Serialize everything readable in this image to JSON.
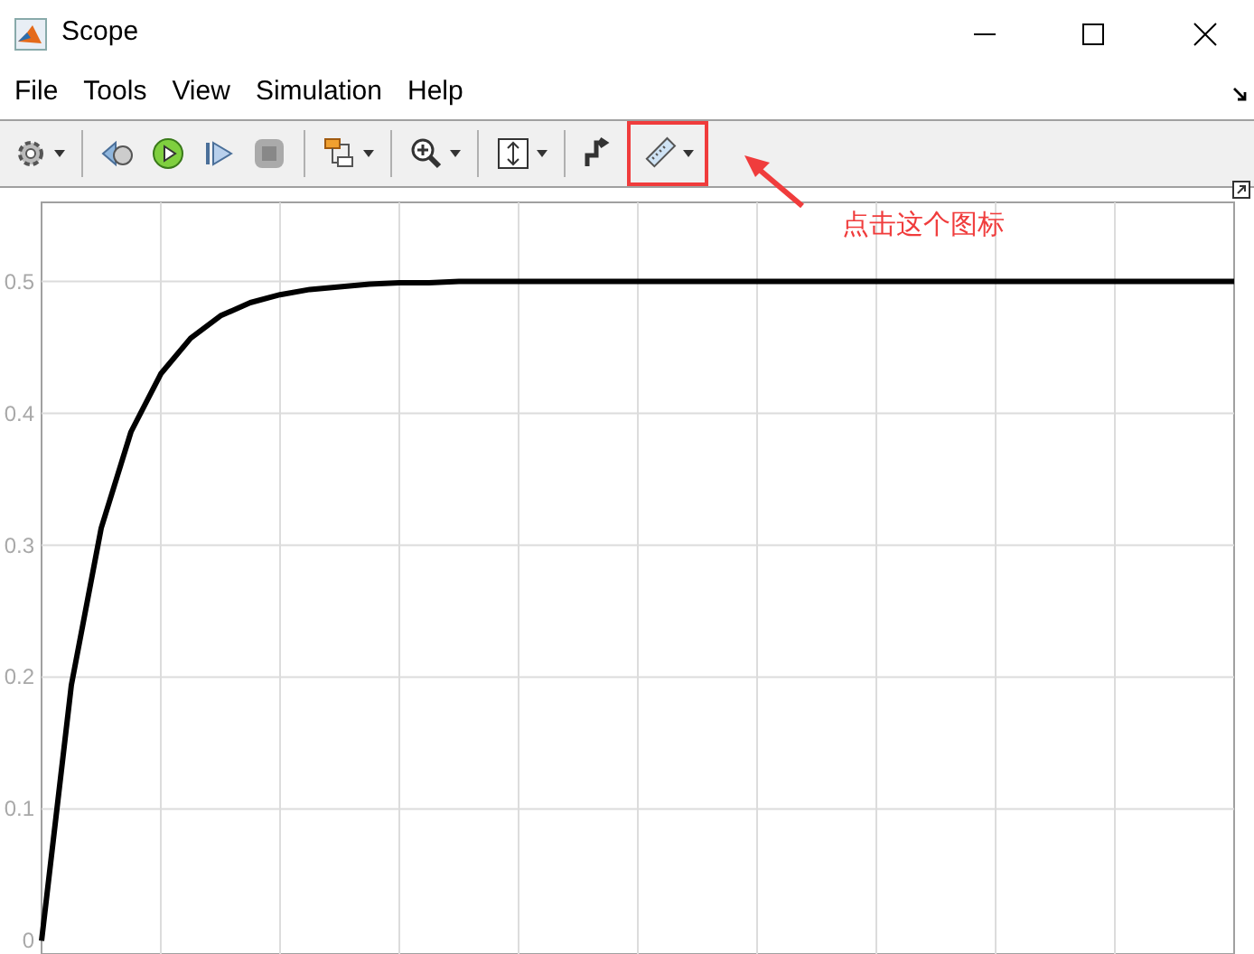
{
  "window": {
    "title": "Scope"
  },
  "menu": [
    {
      "label": "File"
    },
    {
      "label": "Tools"
    },
    {
      "label": "View"
    },
    {
      "label": "Simulation"
    },
    {
      "label": "Help"
    }
  ],
  "toolbar": [
    {
      "kind": "settings",
      "dropdown": true,
      "annotated": false
    },
    {
      "kind": "separator"
    },
    {
      "kind": "step-back",
      "dropdown": false,
      "annotated": false
    },
    {
      "kind": "run",
      "dropdown": false,
      "annotated": false
    },
    {
      "kind": "step-forward",
      "dropdown": false,
      "annotated": false
    },
    {
      "kind": "stop",
      "dropdown": false,
      "annotated": false
    },
    {
      "kind": "separator"
    },
    {
      "kind": "blocks",
      "dropdown": true,
      "annotated": false
    },
    {
      "kind": "separator"
    },
    {
      "kind": "zoom",
      "dropdown": true,
      "annotated": false
    },
    {
      "kind": "separator"
    },
    {
      "kind": "scale",
      "dropdown": true,
      "annotated": false
    },
    {
      "kind": "separator"
    },
    {
      "kind": "signal",
      "dropdown": false,
      "annotated": false
    },
    {
      "kind": "ruler",
      "dropdown": true,
      "annotated": true
    }
  ],
  "annotation": {
    "text": "点击这个图标"
  },
  "plot": {
    "chart_data": {
      "type": "line",
      "grid": true,
      "categories": [
        null,
        null,
        null,
        null,
        null,
        null,
        null,
        null,
        null,
        null,
        null,
        null,
        null,
        null,
        null,
        null,
        null,
        null,
        null,
        null,
        null,
        null,
        null,
        null,
        null,
        null,
        null,
        null,
        null,
        null,
        null,
        null,
        null,
        null,
        null,
        null,
        null,
        null,
        null,
        null,
        null
      ],
      "ylim": [
        -0.01,
        0.56
      ],
      "yticks": [
        {
          "value": 0,
          "label": "0"
        },
        {
          "value": 0.1,
          "label": "0.1"
        },
        {
          "value": 0.2,
          "label": "0.2"
        },
        {
          "value": 0.3,
          "label": "0.3"
        },
        {
          "value": 0.4,
          "label": "0.4"
        },
        {
          "value": 0.5,
          "label": "0.5"
        }
      ],
      "series": [
        {
          "color": "#000000",
          "values": [
            0,
            0.194,
            0.313,
            0.386,
            0.43,
            0.457,
            0.474,
            0.484,
            0.49,
            0.494,
            0.496,
            0.498,
            0.499,
            0.499,
            0.5,
            0.5,
            0.5,
            0.5,
            0.5,
            0.5,
            0.5,
            0.5,
            0.5,
            0.5,
            0.5,
            0.5,
            0.5,
            0.5,
            0.5,
            0.5,
            0.5,
            0.5,
            0.5,
            0.5,
            0.5,
            0.5,
            0.5,
            0.5,
            0.5,
            0.5,
            0.5
          ]
        }
      ]
    }
  }
}
